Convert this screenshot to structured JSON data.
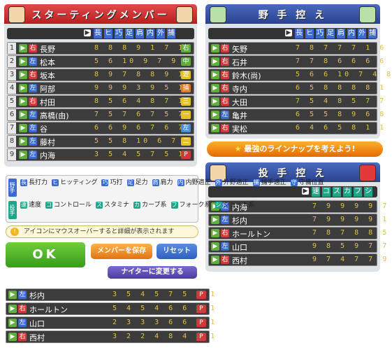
{
  "starting": {
    "title": "スターティングメンバー",
    "headers": [
      "長",
      "ヒ",
      "巧",
      "足",
      "肩",
      "内",
      "外",
      "捕"
    ],
    "rows": [
      {
        "num": "1",
        "hand": "右",
        "name": "長野",
        "stats": "8 8 8 9 1 7 1",
        "pos": "右",
        "pos_color": "#5fae3d"
      },
      {
        "num": "2",
        "hand": "左",
        "name": "松本",
        "stats": "5 6 10 9 7 9 1",
        "pos": "中",
        "pos_color": "#5fae3d"
      },
      {
        "num": "3",
        "hand": "右",
        "name": "坂本",
        "stats": "8 9 7 8 8 9 1",
        "pos": "遊",
        "pos_color": "#e6c229"
      },
      {
        "num": "4",
        "hand": "左",
        "name": "阿部",
        "stats": "9 9 9 3 9 5 1",
        "pos": "捕",
        "pos_color": "#e27a25"
      },
      {
        "num": "5",
        "hand": "右",
        "name": "村田",
        "stats": "8 5 6 4 8 7 1",
        "pos": "三",
        "pos_color": "#e6c229"
      },
      {
        "num": "6",
        "hand": "左",
        "name": "高橋(由)",
        "stats": "7 5 7 6 7 5 7",
        "pos": "一",
        "pos_color": "#e6c229"
      },
      {
        "num": "7",
        "hand": "左",
        "name": "谷",
        "stats": "6 6 9 6 7 6 7",
        "pos": "左",
        "pos_color": "#4a8fd0"
      },
      {
        "num": "8",
        "hand": "左",
        "name": "藤村",
        "stats": "5 5 8 10 6 7 1",
        "pos": "二",
        "pos_color": "#e6c229"
      },
      {
        "num": "9",
        "hand": "左",
        "name": "内海",
        "stats": "3 5 4 5 7 5 1",
        "pos": "P",
        "pos_color": "#d23a3a"
      }
    ]
  },
  "bench_fielders": {
    "title": "野 手 控 え",
    "headers": [
      "長",
      "ヒ",
      "巧",
      "足",
      "肩",
      "内",
      "外",
      "捕"
    ],
    "rows": [
      {
        "hand": "右",
        "name": "矢野",
        "stats": "7 8 7 7 7 1 6 1"
      },
      {
        "hand": "右",
        "name": "石井",
        "stats": "7 7 8 6 6 6 6 1"
      },
      {
        "hand": "右",
        "name": "鈴木(尚)",
        "stats": "5 6 6 10 7 4 8 1"
      },
      {
        "hand": "右",
        "name": "寺内",
        "stats": "6 5 8 8 8 8 1 1"
      },
      {
        "hand": "右",
        "name": "大田",
        "stats": "7 5 4 8 5 7 7 1"
      },
      {
        "hand": "左",
        "name": "亀井",
        "stats": "6 5 5 8 9 6 8 1"
      },
      {
        "hand": "右",
        "name": "実松",
        "stats": "6 4 6 5 8 1 1 7"
      }
    ]
  },
  "banner": "最強のラインナップを考えよう!",
  "bench_pitchers": {
    "title": "投 手 控 え",
    "headers": [
      "速",
      "コ",
      "ス",
      "カ",
      "フ",
      "シ"
    ],
    "rows": [
      {
        "hand": "左",
        "name": "内海",
        "stats": "7 9 9 9 9 7"
      },
      {
        "hand": "左",
        "name": "杉内",
        "stats": "7 9 9 9 9 1"
      },
      {
        "hand": "右",
        "name": "ホールトン",
        "stats": "7 8 7 8 8 5"
      },
      {
        "hand": "左",
        "name": "山口",
        "stats": "9 8 5 9 7 7"
      },
      {
        "hand": "右",
        "name": "西村",
        "stats": "9 7 4 7 7 9"
      }
    ]
  },
  "legend": {
    "fielder_label": "野手",
    "pitcher_label": "投手",
    "fielder_items": [
      {
        "key": "長",
        "text": "長打力",
        "color": "#3a6bd2"
      },
      {
        "key": "ヒ",
        "text": "ヒッティング",
        "color": "#3a6bd2"
      },
      {
        "key": "巧",
        "text": "巧打",
        "color": "#3a6bd2"
      },
      {
        "key": "足",
        "text": "足力",
        "color": "#3a6bd2"
      },
      {
        "key": "肩",
        "text": "肩力",
        "color": "#3a6bd2"
      },
      {
        "key": "内",
        "text": "内野適正",
        "color": "#3a6bd2"
      },
      {
        "key": "外",
        "text": "外野適正",
        "color": "#3a6bd2"
      },
      {
        "key": "捕",
        "text": "捕手適正",
        "color": "#3a6bd2"
      },
      {
        "key": "守",
        "text": "守備位置",
        "color": "#3a6bd2"
      }
    ],
    "pitcher_items": [
      {
        "key": "速",
        "text": "速度",
        "color": "#1fa68a"
      },
      {
        "key": "コ",
        "text": "コントロール",
        "color": "#1fa68a"
      },
      {
        "key": "ス",
        "text": "スタミナ",
        "color": "#1fa68a"
      },
      {
        "key": "カ",
        "text": "カーブ系",
        "color": "#1fa68a"
      },
      {
        "key": "フ",
        "text": "フォーク系",
        "color": "#1fa68a"
      },
      {
        "key": "シ",
        "text": "シュート系",
        "color": "#1fa68a"
      }
    ]
  },
  "tooltip": "アイコンにマウスオーバーすると詳細が表示されます",
  "buttons": {
    "ok": "OK",
    "save": "メンバーを保存",
    "reset": "リセット",
    "night": "ナイターに変更する"
  },
  "extra_pitchers": [
    {
      "hand": "左",
      "name": "杉内",
      "stats": "3 5 4 5 7 5 1 1",
      "pos": "P"
    },
    {
      "hand": "右",
      "name": "ホールトン",
      "stats": "5 4 5 4 6 6 1 1",
      "pos": "P"
    },
    {
      "hand": "左",
      "name": "山口",
      "stats": "2 3 3 3 6 6 1 1",
      "pos": "P"
    },
    {
      "hand": "右",
      "name": "西村",
      "stats": "3 2 2 4 8 4 1 1",
      "pos": "P"
    }
  ]
}
